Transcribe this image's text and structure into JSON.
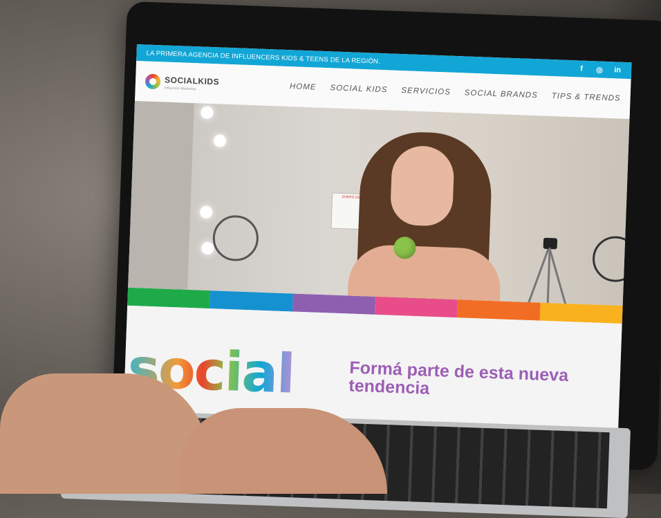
{
  "topbar": {
    "tagline": "LA PRIMERA AGENCIA DE INFLUENCERS KIDS & TEENS DE LA REGIÓN.",
    "social_icons": [
      {
        "name": "facebook-icon",
        "glyph": "f"
      },
      {
        "name": "instagram-icon",
        "glyph": "◎"
      },
      {
        "name": "linkedin-icon",
        "glyph": "in"
      }
    ]
  },
  "brand": {
    "logo_text": "SOCIALKIDS",
    "logo_sub": "Influencer Marketing",
    "colors": {
      "topbar": "#12a6d6",
      "tagline": "#9c5fb5"
    }
  },
  "nav": {
    "items": [
      "HOME",
      "SOCIAL KIDS",
      "SERVICIOS",
      "SOCIAL BRANDS",
      "TIPS & TRENDS"
    ]
  },
  "hero": {
    "calendar_title": "ENERO DE 2022"
  },
  "stripes": [
    "#1faa4a",
    "#1591d0",
    "#8e5fb1",
    "#e84d8a",
    "#f26d24",
    "#f9b21d"
  ],
  "content": {
    "big_word": "social",
    "tagline": "Formá parte de esta nueva tendencia"
  }
}
